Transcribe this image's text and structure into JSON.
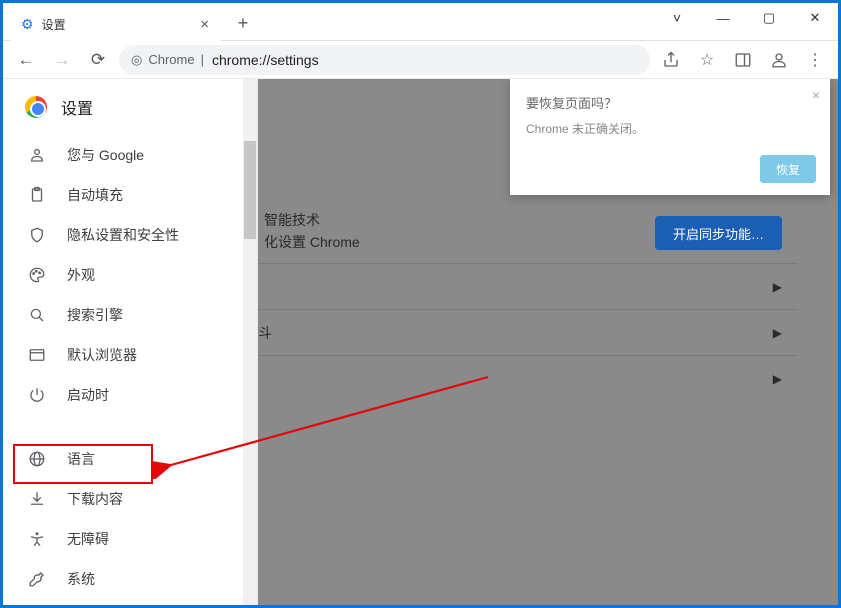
{
  "tab": {
    "title": "设置"
  },
  "omnibox": {
    "secure_label": "Chrome",
    "divider": "|",
    "url": "chrome://settings"
  },
  "sidebar": {
    "title": "设置",
    "items": [
      {
        "label": "您与 Google"
      },
      {
        "label": "自动填充"
      },
      {
        "label": "隐私设置和安全性"
      },
      {
        "label": "外观"
      },
      {
        "label": "搜索引擎"
      },
      {
        "label": "默认浏览器"
      },
      {
        "label": "启动时"
      },
      {
        "label": "语言"
      },
      {
        "label": "下载内容"
      },
      {
        "label": "无障碍"
      },
      {
        "label": "系统"
      }
    ]
  },
  "main": {
    "line1": "智能技术",
    "line2": "化设置 Chrome",
    "sync_button": "开启同步功能…",
    "row_label": "斗"
  },
  "toast": {
    "line1": "要恢复页面吗？",
    "line2": "Chrome 未正确关闭。",
    "restore": "恢复"
  }
}
